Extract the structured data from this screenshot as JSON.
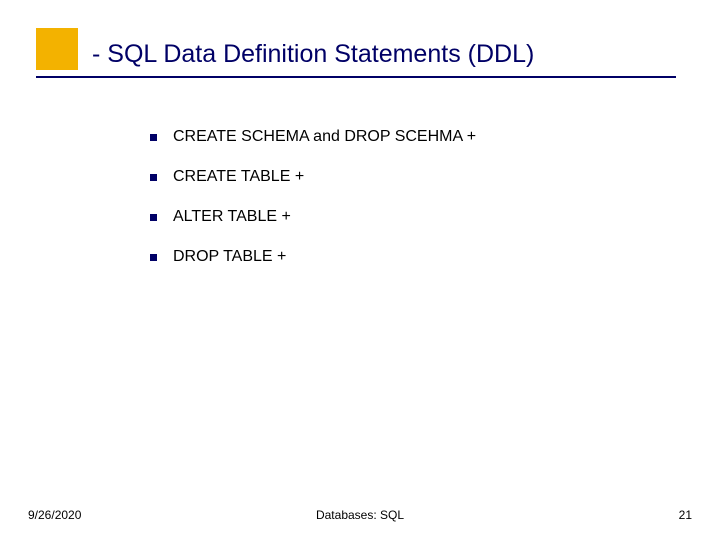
{
  "title": "- SQL Data Definition Statements (DDL)",
  "bullets": [
    "CREATE SCHEMA and DROP SCEHMA +",
    "CREATE TABLE +",
    "ALTER TABLE +",
    "DROP TABLE +"
  ],
  "footer": {
    "date": "9/26/2020",
    "center": "Databases: SQL",
    "page": "21"
  },
  "colors": {
    "accent": "#f3b200",
    "title": "#000066"
  }
}
